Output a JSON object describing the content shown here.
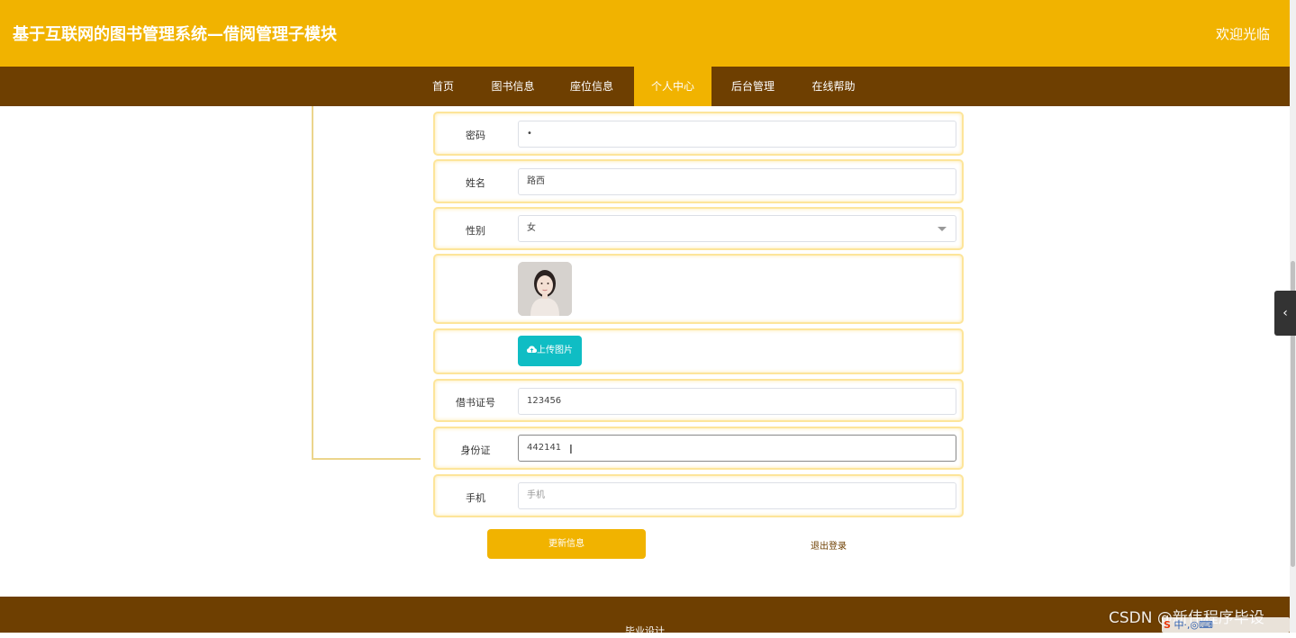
{
  "header": {
    "title": "基于互联网的图书管理系统—借阅管理子模块",
    "welcome": "欢迎光临"
  },
  "nav": {
    "items": [
      {
        "label": "首页",
        "active": false
      },
      {
        "label": "图书信息",
        "active": false
      },
      {
        "label": "座位信息",
        "active": false
      },
      {
        "label": "个人中心",
        "active": true
      },
      {
        "label": "后台管理",
        "active": false
      },
      {
        "label": "在线帮助",
        "active": false
      }
    ]
  },
  "form": {
    "password": {
      "label": "密码",
      "value": "•"
    },
    "name": {
      "label": "姓名",
      "value": "路西"
    },
    "gender": {
      "label": "性别",
      "value": "女"
    },
    "upload": {
      "label": "上传图片",
      "icon": "cloud-upload-icon"
    },
    "card_no": {
      "label": "借书证号",
      "value": "123456"
    },
    "id_card": {
      "label": "身份证",
      "value": "442141"
    },
    "phone": {
      "label": "手机",
      "placeholder": "手机"
    }
  },
  "actions": {
    "update": "更新信息",
    "logout": "退出登录"
  },
  "footer": {
    "text": "毕业设计"
  },
  "watermark": "CSDN @新伟程序毕设",
  "tray": {
    "text": "中·,◎⌨"
  },
  "colors": {
    "header": "#f1b300",
    "nav": "#6e3f01",
    "upload_button": "#0fbdc4",
    "row_border": "#fde59a"
  }
}
